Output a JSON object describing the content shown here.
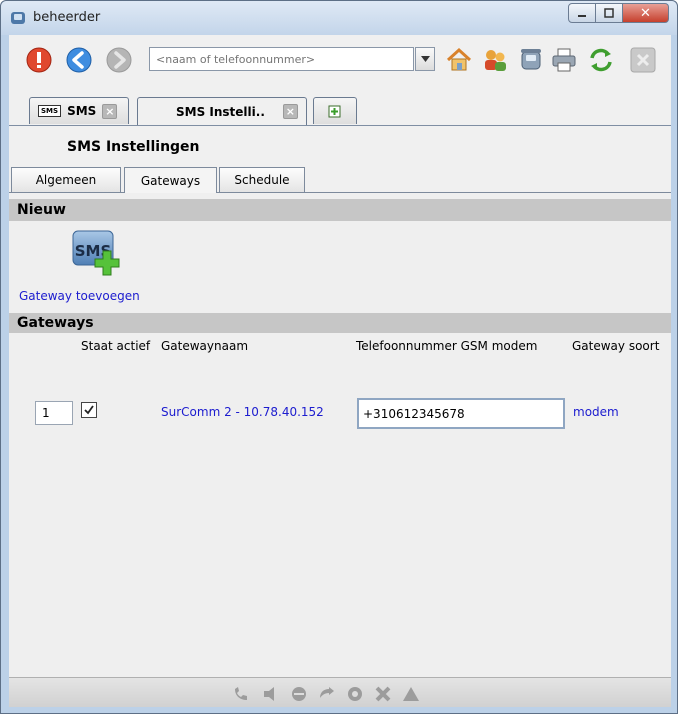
{
  "window": {
    "title": "beheerder",
    "close_glyph": "✕"
  },
  "toolbar": {
    "search_placeholder": "<naam of telefoonnummer>",
    "icons": [
      "stop-icon",
      "back-icon",
      "forward-icon",
      "home-icon",
      "users-icon",
      "phone-icon",
      "print-icon",
      "refresh-icon",
      "close-icon"
    ]
  },
  "doc_tabs": [
    {
      "icon_text": "SMS",
      "label": "SMS",
      "close": "×"
    },
    {
      "label": "SMS Instelli..",
      "close": "×"
    }
  ],
  "page": {
    "title": "SMS Instellingen"
  },
  "sub_tabs": [
    "Algemeen",
    "Gateways",
    "Schedule"
  ],
  "nieuw": {
    "header": "Nieuw",
    "icon_text": "SMS",
    "add_gateway_label": "Gateway toevoegen"
  },
  "gateways": {
    "header": "Gateways",
    "columns": [
      "Staat actief",
      "Gatewaynaam",
      "Telefoonnummer GSM modem",
      "Gateway soort"
    ],
    "rows": [
      {
        "index": "1",
        "active": true,
        "name": "SurComm 2 - 10.78.40.152",
        "phone": "+310612345678",
        "type": "modem"
      }
    ]
  },
  "colors": {
    "link": "#1c1ccf",
    "section_header": "#c6c6c6",
    "window_frame": "#bcd1e8"
  }
}
